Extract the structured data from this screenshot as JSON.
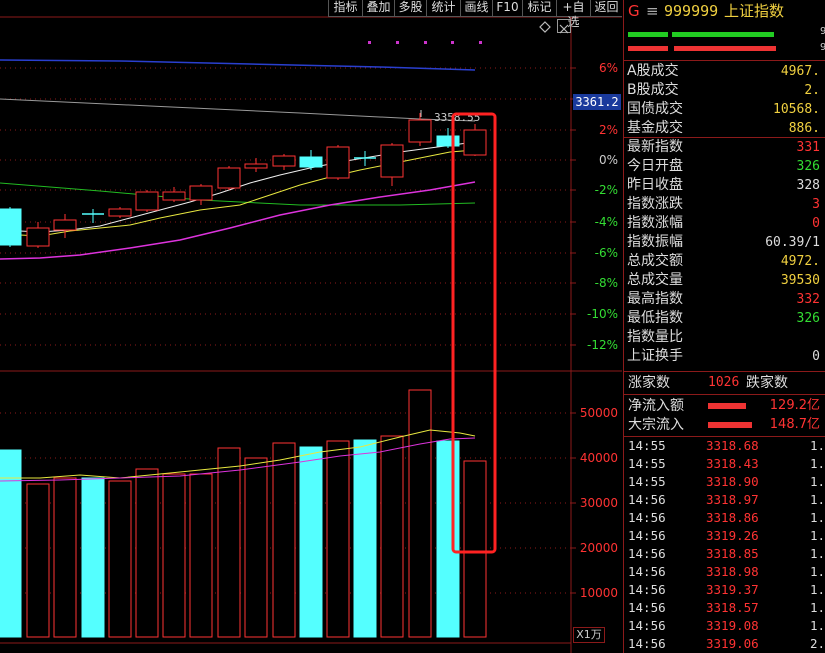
{
  "toolbar": {
    "buttons": [
      "指标",
      "叠加",
      "多股",
      "统计",
      "画线",
      "F10",
      "标记",
      "+自选",
      "返回"
    ]
  },
  "header": {
    "g_mark": "G",
    "menu_icon": "menu-icon",
    "code": "999999",
    "name": "上证指数",
    "side_digits": [
      "9",
      "9"
    ]
  },
  "main_chart": {
    "price_label": "3361.2",
    "high_marker": "3358.55",
    "pct_labels": [
      "6%",
      "4%",
      "2%",
      "0%",
      "-2%",
      "-4%",
      "-6%",
      "-8%",
      "-10%",
      "-12%"
    ],
    "volume_labels": [
      "50000",
      "40000",
      "30000",
      "20000",
      "10000"
    ],
    "volume_unit": "X1万"
  },
  "quote": {
    "rows": [
      {
        "label": "A股成交",
        "value": "4967.",
        "color": "#f0d040"
      },
      {
        "label": "B股成交",
        "value": "2.",
        "color": "#f0d040"
      },
      {
        "label": "国债成交",
        "value": "10568.",
        "color": "#f0d040"
      },
      {
        "label": "基金成交",
        "value": "886.",
        "color": "#f0d040"
      },
      {
        "label": "最新指数",
        "value": "331",
        "color": "#ff3333"
      },
      {
        "label": "今日开盘",
        "value": "326",
        "color": "#33dd33"
      },
      {
        "label": "昨日收盘",
        "value": "328",
        "color": "#dddddd"
      },
      {
        "label": "指数涨跌",
        "value": "3",
        "color": "#ff3333"
      },
      {
        "label": "指数涨幅",
        "value": "0",
        "color": "#ff3333"
      },
      {
        "label": "指数振幅",
        "value": "60.39/1",
        "color": "#dddddd"
      },
      {
        "label": "总成交额",
        "value": "4972.",
        "color": "#f0d040"
      },
      {
        "label": "总成交量",
        "value": "39530",
        "color": "#f0d040"
      },
      {
        "label": "最高指数",
        "value": "332",
        "color": "#ff3333"
      },
      {
        "label": "最低指数",
        "value": "326",
        "color": "#33dd33"
      },
      {
        "label": "指数量比",
        "value": "",
        "color": "#dddddd"
      },
      {
        "label": "上证换手",
        "value": "0",
        "color": "#dddddd"
      }
    ],
    "updown": {
      "up_label": "涨家数",
      "up_value": "1026",
      "down_label": "跌家数"
    },
    "flows": [
      {
        "label": "净流入额",
        "value": "129.2亿"
      },
      {
        "label": "大宗流入",
        "value": "148.7亿"
      }
    ]
  },
  "ticks": [
    {
      "time": "14:55",
      "price": "3318.68",
      "vol": "1."
    },
    {
      "time": "14:55",
      "price": "3318.43",
      "vol": "1."
    },
    {
      "time": "14:55",
      "price": "3318.90",
      "vol": "1."
    },
    {
      "time": "14:56",
      "price": "3318.97",
      "vol": "1."
    },
    {
      "time": "14:56",
      "price": "3318.86",
      "vol": "1."
    },
    {
      "time": "14:56",
      "price": "3319.26",
      "vol": "1."
    },
    {
      "time": "14:56",
      "price": "3318.85",
      "vol": "1."
    },
    {
      "time": "14:56",
      "price": "3318.98",
      "vol": "1."
    },
    {
      "time": "14:56",
      "price": "3319.37",
      "vol": "1."
    },
    {
      "time": "14:56",
      "price": "3318.57",
      "vol": "1."
    },
    {
      "time": "14:56",
      "price": "3319.08",
      "vol": "1."
    },
    {
      "time": "14:56",
      "price": "3319.06",
      "vol": "2."
    }
  ]
}
